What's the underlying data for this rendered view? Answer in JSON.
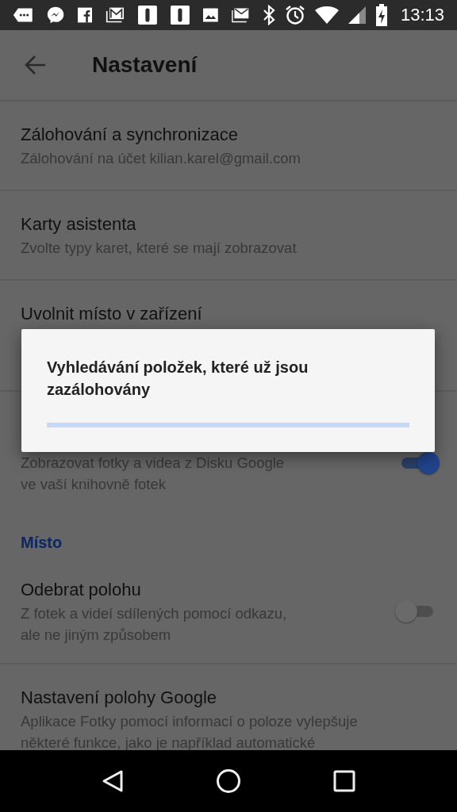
{
  "status_bar": {
    "time": "13:13"
  },
  "app_bar": {
    "title": "Nastavení"
  },
  "settings": [
    {
      "kind": "item",
      "title": "Zálohování a synchronizace",
      "subtitle": "Zálohování na účet kilian.karel@gmail.com"
    },
    {
      "kind": "item",
      "title": "Karty asistenta",
      "subtitle": "Zvolte typy karet, které se mají zobrazovat"
    },
    {
      "kind": "item",
      "title": "Uvolnit místo v zařízení"
    },
    {
      "kind": "toggle",
      "subtitle": "Zobrazovat fotky a videa z Disku Google\nve vaší knihovně fotek",
      "on": true
    },
    {
      "kind": "header",
      "title": "Místo"
    },
    {
      "kind": "toggle",
      "title": "Odebrat polohu",
      "subtitle": "Z fotek a videí sdílených pomocí odkazu,\nale ne jiným způsobem",
      "on": false
    },
    {
      "kind": "item",
      "title": "Nastavení polohy Google",
      "subtitle": "Aplikace Fotky pomocí informací o poloze vylepšuje\nněkteré funkce, jako je například automatické"
    }
  ],
  "dialog": {
    "message": "Vyhledávání položek, které už jsou zazálohovány",
    "level": 0
  }
}
